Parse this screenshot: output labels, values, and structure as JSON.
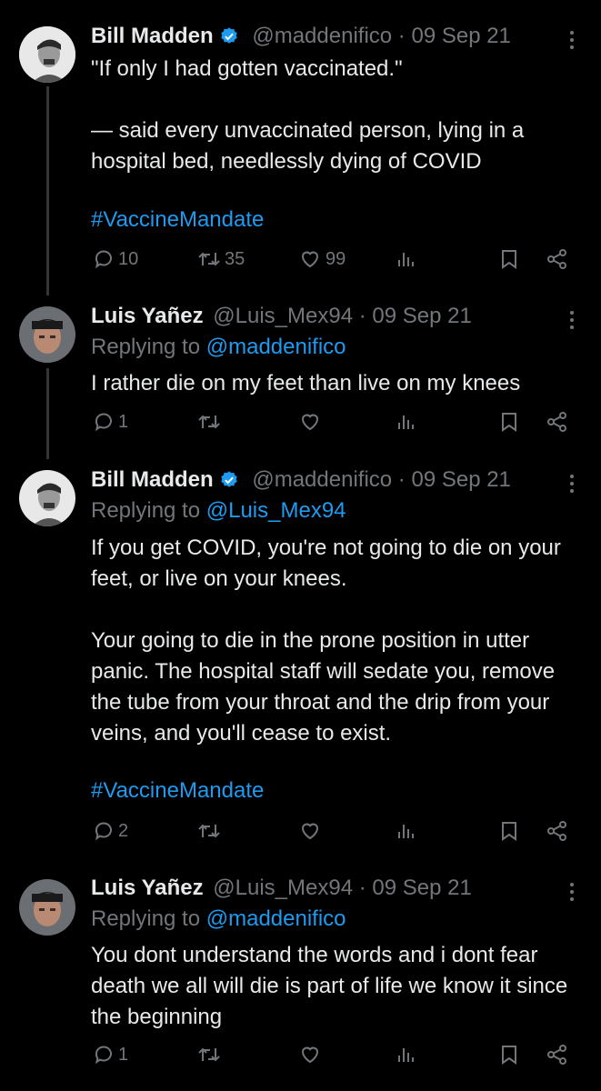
{
  "tweets": [
    {
      "name": "Bill Madden",
      "handle": "@maddenifico",
      "sep": "·",
      "date": "09 Sep 21",
      "verified": true,
      "reply_label": "",
      "reply_mention": "",
      "text": "\"If only I had gotten vaccinated.\"\n\n— said every unvaccinated person, lying in a hospital bed, needlessly dying of COVID",
      "hashtag": "#VaccineMandate",
      "replies": "10",
      "retweets": "35",
      "likes": "99"
    },
    {
      "name": "Luis Yañez",
      "handle": "@Luis_Mex94",
      "sep": "·",
      "date": "09 Sep 21",
      "verified": false,
      "reply_label": "Replying to ",
      "reply_mention": "@maddenifico",
      "text": "I rather die on my feet than live on my knees",
      "hashtag": "",
      "replies": "1",
      "retweets": "",
      "likes": ""
    },
    {
      "name": "Bill Madden",
      "handle": "@maddenifico",
      "sep": "·",
      "date": "09 Sep 21",
      "verified": true,
      "reply_label": "Replying to ",
      "reply_mention": "@Luis_Mex94",
      "text": "If you get COVID, you're not going to die on your feet, or live on your knees.\n\nYour going to die in the prone position in utter panic. The hospital staff will sedate you, remove the tube from your throat and the drip from your veins, and you'll cease to exist.",
      "hashtag": "#VaccineMandate",
      "replies": "2",
      "retweets": "",
      "likes": ""
    },
    {
      "name": "Luis Yañez",
      "handle": "@Luis_Mex94",
      "sep": "·",
      "date": "09 Sep 21",
      "verified": false,
      "reply_label": "Replying to ",
      "reply_mention": "@maddenifico",
      "text": "You dont understand the words and i dont fear death we all will die is part of life we know it since the beginning",
      "hashtag": "",
      "replies": "1",
      "retweets": "",
      "likes": ""
    }
  ],
  "colors": {
    "background": "#000000",
    "text": "#e7e9ea",
    "muted": "#71767b",
    "link": "#1d9bf0",
    "thread_line": "#333639"
  },
  "icons": [
    "reply-icon",
    "retweet-icon",
    "like-icon",
    "views-icon",
    "bookmark-icon",
    "share-icon",
    "more-icon",
    "verified-badge-icon"
  ]
}
